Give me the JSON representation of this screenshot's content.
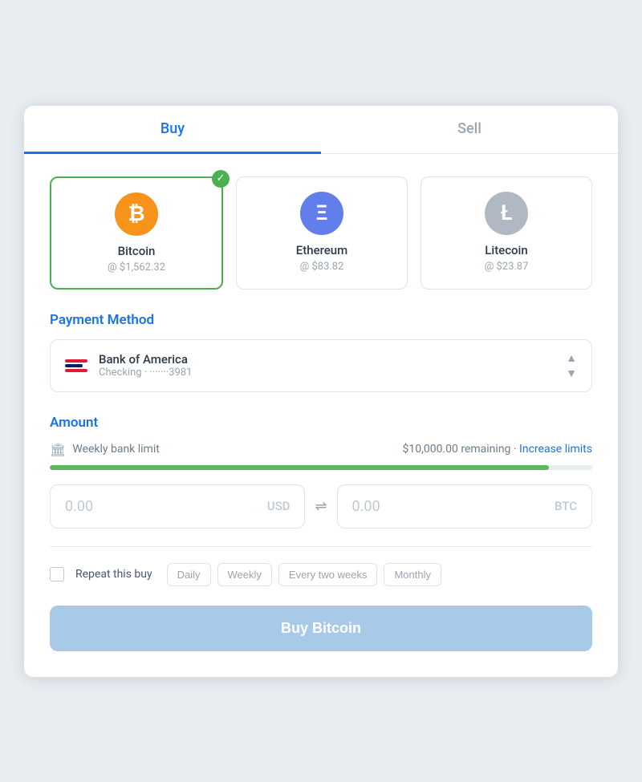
{
  "tabs": [
    {
      "id": "buy",
      "label": "Buy",
      "active": true
    },
    {
      "id": "sell",
      "label": "Sell",
      "active": false
    }
  ],
  "cryptos": [
    {
      "id": "bitcoin",
      "name": "Bitcoin",
      "price": "@ $1,562.32",
      "symbol": "₿",
      "iconClass": "bitcoin-icon",
      "selected": true
    },
    {
      "id": "ethereum",
      "name": "Ethereum",
      "price": "@ $83.82",
      "symbol": "Ξ",
      "iconClass": "ethereum-icon",
      "selected": false
    },
    {
      "id": "litecoin",
      "name": "Litecoin",
      "price": "@ $23.87",
      "symbol": "Ł",
      "iconClass": "litecoin-icon",
      "selected": false
    }
  ],
  "payment_method": {
    "section_title": "Payment Method",
    "name": "Bank of America",
    "sub": "Checking · ·······3981"
  },
  "amount": {
    "section_title": "Amount",
    "limit_label": "Weekly bank limit",
    "limit_remaining": "$10,000.00 remaining",
    "limit_separator": "·",
    "increase_limits": "Increase limits",
    "progress_percent": 92,
    "usd_value": "0.00",
    "usd_currency": "USD",
    "btc_value": "0.00",
    "btc_currency": "BTC"
  },
  "repeat": {
    "label": "Repeat this buy",
    "frequencies": [
      {
        "id": "daily",
        "label": "Daily"
      },
      {
        "id": "weekly",
        "label": "Weekly"
      },
      {
        "id": "every-two-weeks",
        "label": "Every two weeks"
      },
      {
        "id": "monthly",
        "label": "Monthly"
      }
    ]
  },
  "buy_button_label": "Buy Bitcoin"
}
